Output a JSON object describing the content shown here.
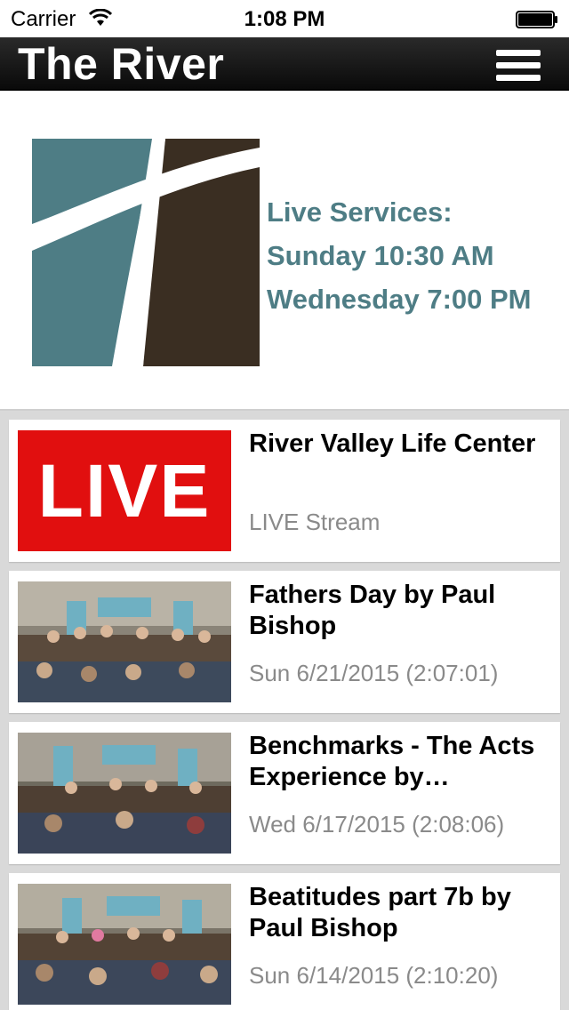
{
  "status_bar": {
    "carrier": "Carrier",
    "time": "1:08 PM",
    "icons": [
      "wifi-icon",
      "battery-icon"
    ]
  },
  "nav": {
    "title": "The River",
    "menu_icon": "hamburger-menu-icon"
  },
  "banner": {
    "logo": "river-cross-logo",
    "lines": [
      "Live Services:",
      "Sunday 10:30 AM",
      "Wednesday 7:00 PM"
    ],
    "text_color": "#4e7d85"
  },
  "items": [
    {
      "title": "River Valley Life Center",
      "subtitle": "LIVE Stream",
      "thumbnail": "live-badge",
      "thumb_text": "LIVE"
    },
    {
      "title": "Fathers Day by Paul Bishop",
      "subtitle": "Sun 6/21/2015 (2:07:01)",
      "thumbnail": "church-service-photo"
    },
    {
      "title": "Benchmarks - The Acts Experience by…",
      "subtitle": "Wed 6/17/2015 (2:08:06)",
      "thumbnail": "church-service-photo"
    },
    {
      "title": "Beatitudes part 7b by Paul Bishop",
      "subtitle": "Sun 6/14/2015 (2:10:20)",
      "thumbnail": "church-service-photo"
    }
  ],
  "colors": {
    "live_red": "#e10f0f",
    "logo_teal": "#4e7d85",
    "logo_brown": "#3a2e22",
    "nav_bg": "#111111"
  }
}
